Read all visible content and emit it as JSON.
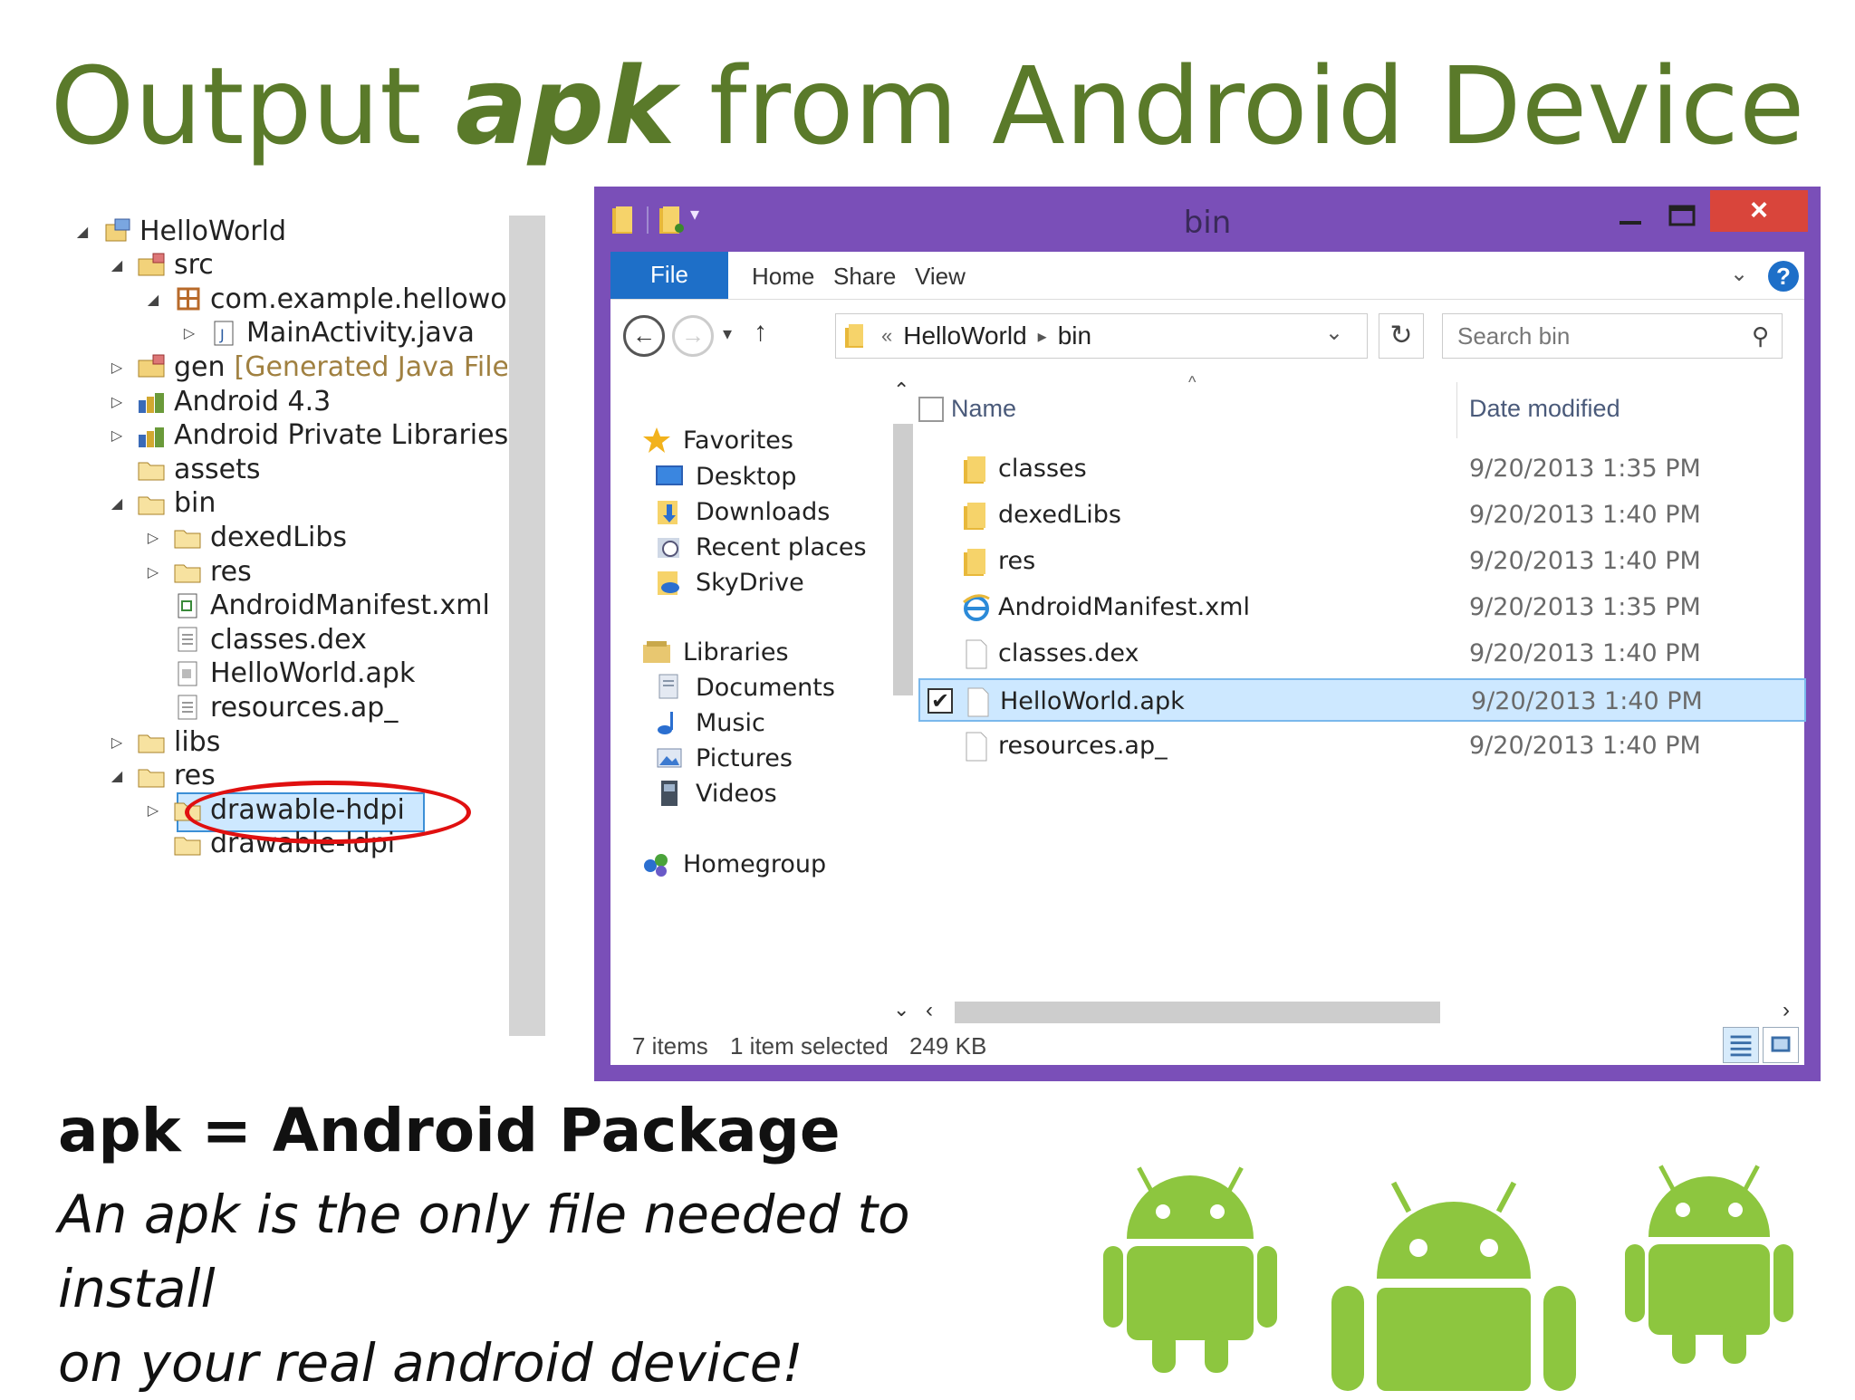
{
  "slide": {
    "title_pre": "Output ",
    "title_em": "apk",
    "title_post": " from Android Device",
    "definition": "apk = Android Package",
    "description_line1": "An apk is the only file needed to install",
    "description_line2": "on your real android device!"
  },
  "eclipse_tree": {
    "items": [
      {
        "label": "HelloWorld",
        "icon": "project-icon"
      },
      {
        "label": "src",
        "icon": "source-folder-icon"
      },
      {
        "label": "com.example.hellowor",
        "icon": "package-icon"
      },
      {
        "label": "MainActivity.java",
        "icon": "java-file-icon"
      },
      {
        "label": "gen",
        "note": "[Generated Java Files",
        "icon": "source-folder-icon"
      },
      {
        "label": "Android 4.3",
        "icon": "library-icon"
      },
      {
        "label": "Android Private Libraries",
        "icon": "library-icon"
      },
      {
        "label": "assets",
        "icon": "folder-icon"
      },
      {
        "label": "bin",
        "icon": "folder-icon"
      },
      {
        "label": "dexedLibs",
        "icon": "folder-icon"
      },
      {
        "label": "res",
        "icon": "folder-icon"
      },
      {
        "label": "AndroidManifest.xml",
        "icon": "xml-file-icon"
      },
      {
        "label": "classes.dex",
        "icon": "file-icon"
      },
      {
        "label": "HelloWorld.apk",
        "icon": "apk-file-icon"
      },
      {
        "label": "resources.ap_",
        "icon": "file-icon"
      },
      {
        "label": "libs",
        "icon": "folder-icon"
      },
      {
        "label": "res",
        "icon": "folder-icon"
      },
      {
        "label": "drawable-hdpi",
        "icon": "folder-icon"
      },
      {
        "label": "drawable-ldpi",
        "icon": "folder-icon"
      }
    ]
  },
  "explorer": {
    "window_title": "bin",
    "close_label": "×",
    "ribbon": {
      "file": "File",
      "home": "Home",
      "share": "Share",
      "view": "View",
      "help": "?"
    },
    "address": {
      "chevrons": "«",
      "part1": "HelloWorld",
      "sep": "▸",
      "part2": "bin"
    },
    "search_placeholder": "Search bin",
    "nav": {
      "favorites": "Favorites",
      "desktop": "Desktop",
      "downloads": "Downloads",
      "recent": "Recent places",
      "skydrive": "SkyDrive",
      "libraries": "Libraries",
      "documents": "Documents",
      "music": "Music",
      "pictures": "Pictures",
      "videos": "Videos",
      "homegroup": "Homegroup"
    },
    "columns": {
      "name": "Name",
      "date": "Date modified"
    },
    "files": [
      {
        "name": "classes",
        "date": "9/20/2013 1:35 PM",
        "icon": "folder-icon"
      },
      {
        "name": "dexedLibs",
        "date": "9/20/2013 1:40 PM",
        "icon": "folder-icon"
      },
      {
        "name": "res",
        "date": "9/20/2013 1:40 PM",
        "icon": "folder-icon"
      },
      {
        "name": "AndroidManifest.xml",
        "date": "9/20/2013 1:35 PM",
        "icon": "ie-file-icon"
      },
      {
        "name": "classes.dex",
        "date": "9/20/2013 1:40 PM",
        "icon": "file-icon"
      },
      {
        "name": "HelloWorld.apk",
        "date": "9/20/2013 1:40 PM",
        "icon": "file-icon",
        "selected": true
      },
      {
        "name": "resources.ap_",
        "date": "9/20/2013 1:40 PM",
        "icon": "file-icon"
      }
    ],
    "status": {
      "count": "7 items",
      "selection": "1 item selected",
      "size": "249 KB"
    }
  },
  "colors": {
    "title_green": "#5a7a2a",
    "window_frame": "#7a4fb8",
    "ribbon_blue": "#1e6fc8",
    "highlight_red": "#e01010",
    "android_green": "#8dc63f"
  }
}
